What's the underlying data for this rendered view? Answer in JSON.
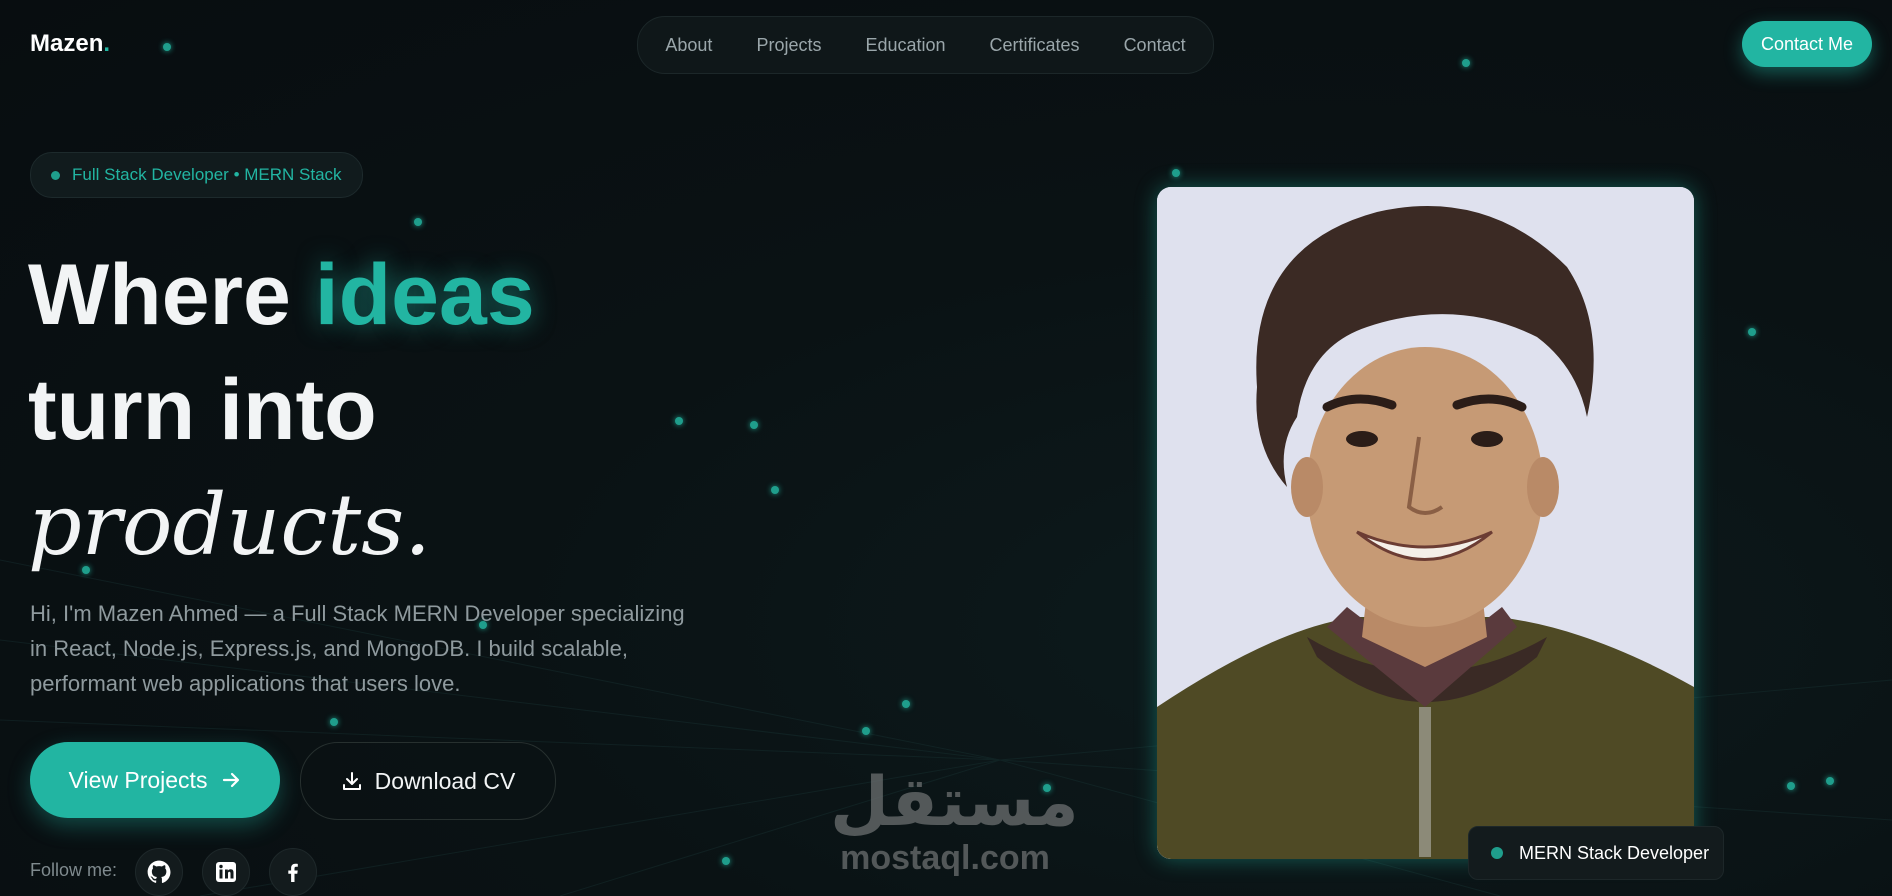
{
  "header": {
    "logo_text": "Mazen",
    "logo_dot": ".",
    "nav": [
      "About",
      "Projects",
      "Education",
      "Certificates",
      "Contact"
    ],
    "contact_button": "Contact Me"
  },
  "hero": {
    "badge": "Full Stack Developer • MERN Stack",
    "headline": {
      "part1": "Where ",
      "highlight": "ideas",
      "line2": "turn into",
      "line3_italic": "products",
      "line3_end": "."
    },
    "description": "Hi, I'm Mazen Ahmed — a Full Stack MERN Developer specializing in React, Node.js, Express.js, and MongoDB. I build scalable, performant web applications that users love.",
    "primary_button": "View Projects",
    "secondary_button": "Download CV",
    "follow_label": "Follow me:",
    "social": [
      "github-icon",
      "linkedin-icon",
      "facebook-icon"
    ]
  },
  "profile": {
    "role_chip": "MERN Stack Developer"
  },
  "watermark": {
    "arabic": "مستقل",
    "latin": "mostaql.com"
  },
  "colors": {
    "accent": "#22b5a2",
    "background": "#0a1214",
    "text_muted": "#8f9a9e"
  }
}
